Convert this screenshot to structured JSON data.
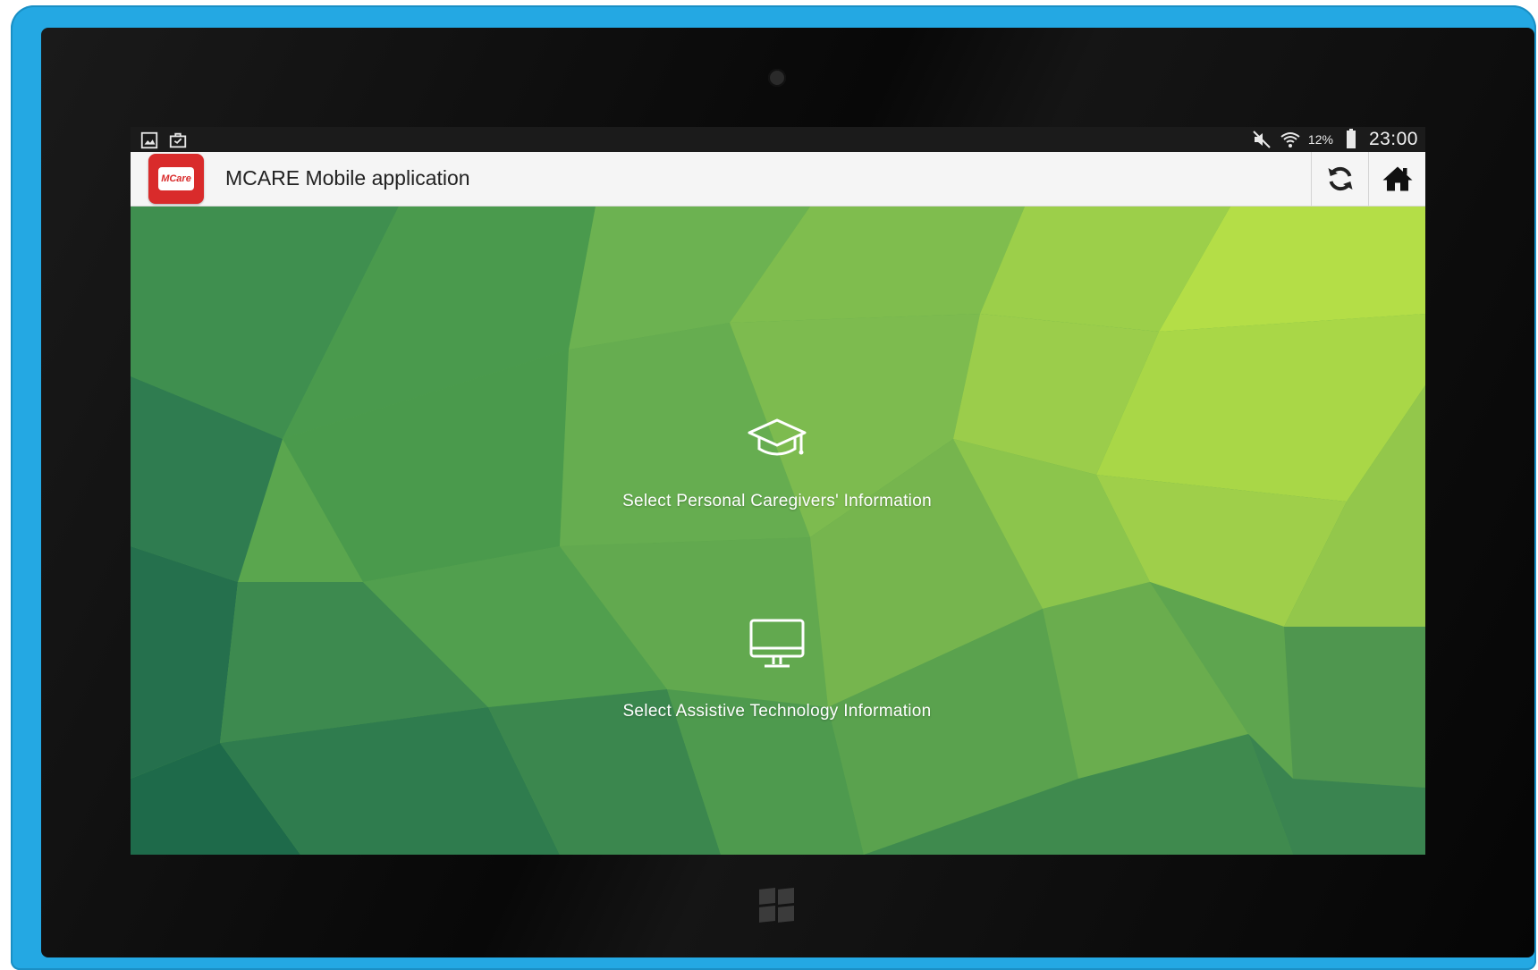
{
  "status_bar": {
    "battery_percent": "12%",
    "time": "23:00",
    "left_icons": [
      "gallery-icon",
      "briefcase-icon"
    ],
    "right_icons": [
      "mute-icon",
      "wifi-icon",
      "battery-icon"
    ]
  },
  "app_bar": {
    "title": "MCARE Mobile application",
    "logo_text": "MCare",
    "actions": [
      "refresh-icon",
      "home-icon"
    ]
  },
  "options": [
    {
      "icon": "graduation-cap-icon",
      "label": "Select Personal Caregivers' Information"
    },
    {
      "icon": "monitor-icon",
      "label": "Select Assistive Technology Information"
    }
  ],
  "colors": {
    "frame": "#24a8e3",
    "app_icon": "#d92b2b",
    "background_dark": "#2d7a4e",
    "background_light": "#b7e04a"
  }
}
